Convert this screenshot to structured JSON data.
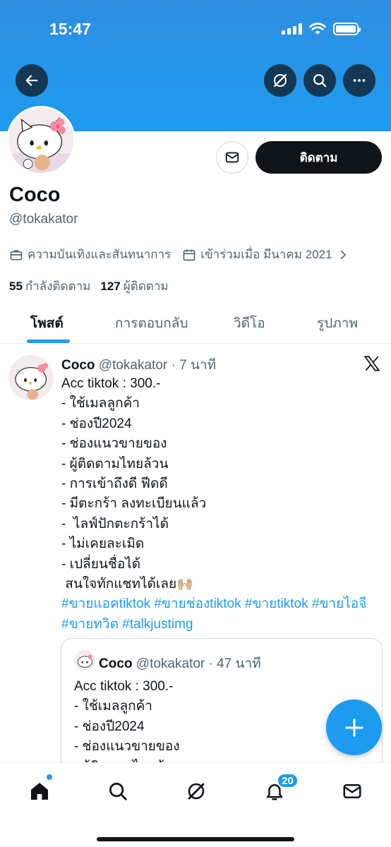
{
  "status_bar": {
    "time": "15:47"
  },
  "profile": {
    "name": "Coco",
    "handle": "@tokakator",
    "category": "ความบันเทิงและสันทนาการ",
    "joined": "เข้าร่วมเมื่อ มีนาคม 2021",
    "following_count": "55",
    "following_label": "กำลังติดตาม",
    "followers_count": "127",
    "followers_label": "ผู้ติดตาม",
    "follow_button": "ติดตาม"
  },
  "tabs": [
    {
      "label": "โพสต์",
      "active": true
    },
    {
      "label": "การตอบกลับ",
      "active": false
    },
    {
      "label": "วิดีโอ",
      "active": false
    },
    {
      "label": "รูปภาพ",
      "active": false
    }
  ],
  "post": {
    "author": "Coco",
    "meta": "@tokakator · 7 นาที",
    "lines": [
      "Acc tiktok : 300.-",
      "- ใช้เมลลูกค้า",
      "- ช่องปี2024",
      "- ช่องแนวขายของ",
      "- ผู้ติดตามไทยล้วน",
      "- การเข้าถึงดี ฟีดดี",
      "- มีตะกร้า ลงทะเบียนแล้ว",
      "-  ไลฟ์ปักตะกร้าได้",
      "- ไม่เคยละเมิด",
      "- เปลี่ยนชื่อได้",
      " สนใจทักแชทได้เลย🙌🏼"
    ],
    "hashtags": "#ขายแอคtiktok #ขายช่องtiktok #ขายtiktok #ขายไอจี #ขายทวิต #talkjustimg"
  },
  "quote": {
    "author": "Coco",
    "meta": "@tokakator · 47 นาที",
    "lines": [
      "Acc tiktok : 300.-",
      "- ใช้เมลลูกค้า",
      "- ช่องปี2024",
      "- ช่องแนวขายของ",
      "- ผู้ติดตามไทยล้วน"
    ]
  },
  "bottom_nav": {
    "notifications_badge": "20"
  },
  "colors": {
    "accent": "#1d9bf0",
    "banner": "#1d9bf0",
    "dark": "#0f1419",
    "muted": "#536471"
  },
  "icons": [
    "back-arrow-icon",
    "grok-icon",
    "search-icon",
    "more-icon",
    "mail-icon",
    "briefcase-icon",
    "calendar-icon",
    "chevron-right-icon",
    "x-logo-icon",
    "plus-icon",
    "home-icon",
    "notifications-icon"
  ]
}
